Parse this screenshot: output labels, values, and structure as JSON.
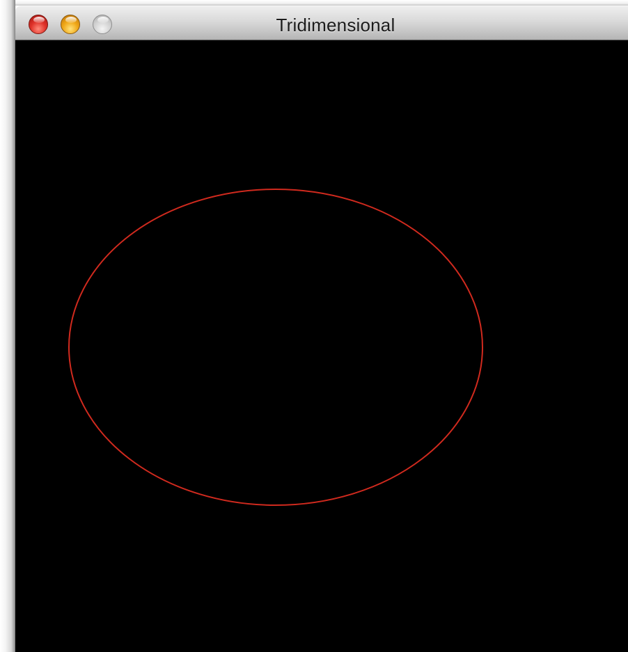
{
  "window": {
    "title": "Tridimensional"
  },
  "titlebar": {
    "buttons": [
      {
        "name": "close",
        "icon": "close-icon",
        "color": "#e0332a"
      },
      {
        "name": "minimize",
        "icon": "minimize-icon",
        "color": "#f0a818"
      },
      {
        "name": "zoom",
        "icon": "zoom-icon",
        "color": "#d2d2d2",
        "state": "disabled"
      }
    ]
  },
  "canvas": {
    "background_color": "#000000",
    "shape": {
      "type": "ellipse",
      "stroke_color": "#d12a1e"
    }
  }
}
